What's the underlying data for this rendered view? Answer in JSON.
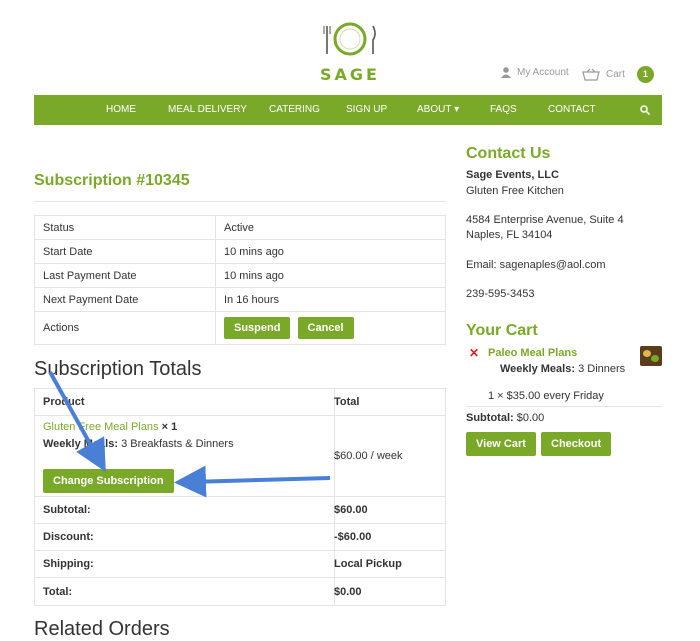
{
  "header": {
    "brand": "SAGE",
    "my_account": "My Account",
    "cart_label": "Cart",
    "cart_count": "1"
  },
  "nav": {
    "items": [
      "HOME",
      "MEAL DELIVERY",
      "CATERING",
      "SIGN UP",
      "ABOUT",
      "FAQS",
      "CONTACT"
    ]
  },
  "subscription": {
    "title": "Subscription #10345",
    "rows": [
      {
        "label": "Status",
        "value": "Active"
      },
      {
        "label": "Start Date",
        "value": "10 mins ago"
      },
      {
        "label": "Last Payment Date",
        "value": "10 mins ago"
      },
      {
        "label": "Next Payment Date",
        "value": "In 16 hours"
      }
    ],
    "actions_label": "Actions",
    "suspend_label": "Suspend",
    "cancel_label": "Cancel"
  },
  "totals": {
    "title": "Subscription Totals",
    "col_product": "Product",
    "col_total": "Total",
    "product_name": "Gluten Free Meal Plans",
    "product_qty": "× 1",
    "meta_label": "Weekly Meals:",
    "meta_value": "3 Breakfasts & Dinners",
    "line_total": "$60.00 / week",
    "change_label": "Change Subscription",
    "rows": [
      {
        "label": "Subtotal:",
        "value": "$60.00"
      },
      {
        "label": "Discount:",
        "value": "-$60.00"
      },
      {
        "label": "Shipping:",
        "value": "Local Pickup"
      },
      {
        "label": "Total:",
        "value": "$0.00"
      }
    ]
  },
  "related": {
    "title": "Related Orders"
  },
  "contact": {
    "title": "Contact Us",
    "company": "Sage Events, LLC",
    "tagline": "Gluten Free Kitchen",
    "address1": "4584 Enterprise Avenue, Suite 4",
    "address2": "Naples, FL 34104",
    "email": "Email: sagenaples@aol.com",
    "phone": "239-595-3453"
  },
  "cart": {
    "title": "Your Cart",
    "item_name": "Paleo Meal Plans",
    "meta_label": "Weekly Meals:",
    "meta_value": "3 Dinners",
    "item_price": "1 × $35.00 every Friday",
    "subtotal_label": "Subtotal:",
    "subtotal_value": "$0.00",
    "view_cart_label": "View Cart",
    "checkout_label": "Checkout"
  },
  "colors": {
    "accent": "#7aa92a",
    "arrow": "#4a7fd6",
    "remove": "#d9241b"
  }
}
